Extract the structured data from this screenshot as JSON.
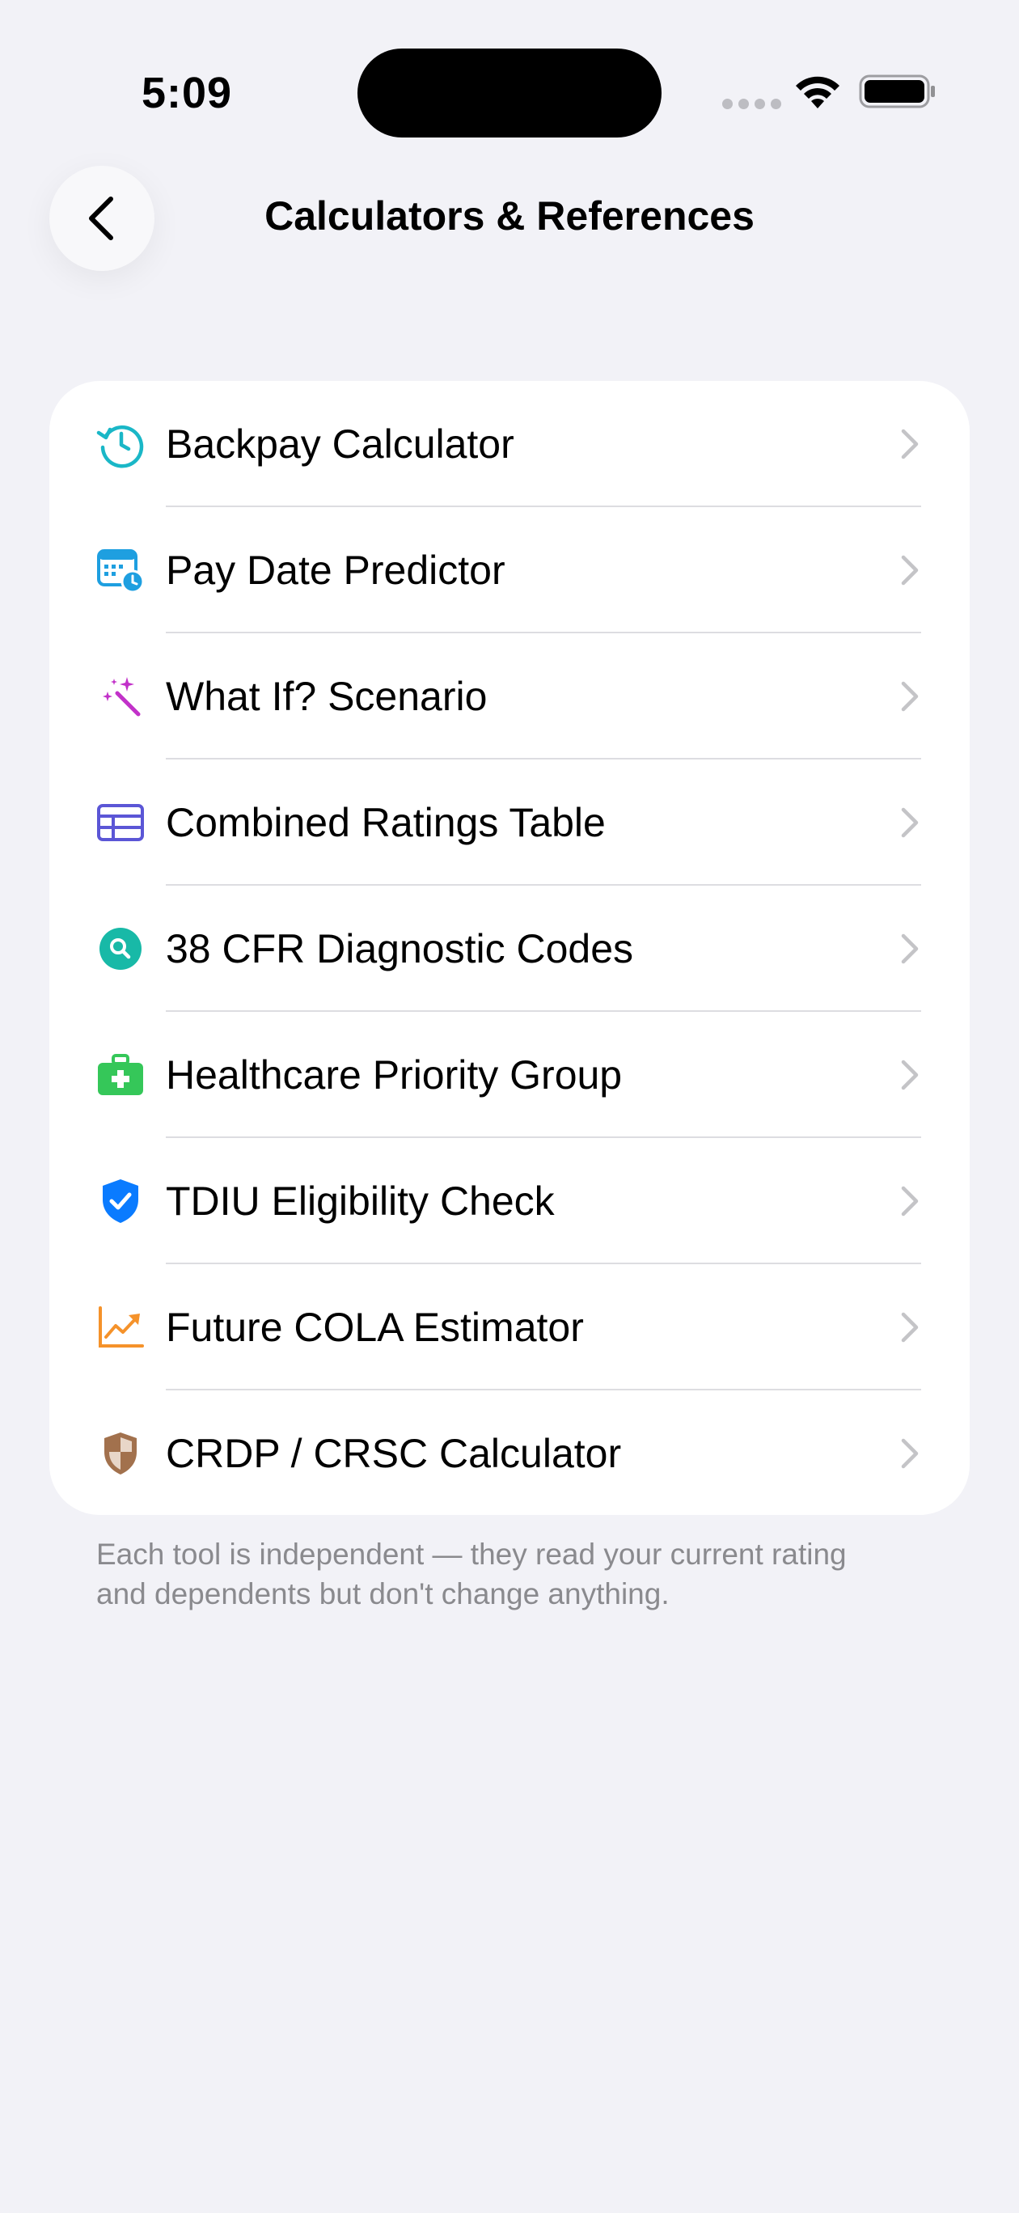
{
  "status_bar": {
    "time": "5:09"
  },
  "header": {
    "title": "Calculators & References",
    "back_icon": "chevron-left-icon"
  },
  "tools": [
    {
      "label": "Backpay Calculator",
      "icon": "clock-history-icon",
      "color": "#1AB7C7"
    },
    {
      "label": "Pay Date Predictor",
      "icon": "calendar-clock-icon",
      "color": "#1E9FE0"
    },
    {
      "label": "What If? Scenario",
      "icon": "magic-wand-icon",
      "color": "#C231C9"
    },
    {
      "label": "Combined Ratings Table",
      "icon": "table-icon",
      "color": "#5B56D6"
    },
    {
      "label": "38 CFR Diagnostic Codes",
      "icon": "magnifier-icon",
      "color": "#18B9A7"
    },
    {
      "label": "Healthcare Priority Group",
      "icon": "medical-kit-icon",
      "color": "#35C759"
    },
    {
      "label": "TDIU Eligibility Check",
      "icon": "shield-check-icon",
      "color": "#0A7BFF"
    },
    {
      "label": "Future COLA Estimator",
      "icon": "trend-chart-icon",
      "color": "#F5922A"
    },
    {
      "label": "CRDP / CRSC Calculator",
      "icon": "shield-half-icon",
      "color": "#A2714D"
    }
  ],
  "footnote": "Each tool is independent — they read your current rating and dependents but don't change anything."
}
